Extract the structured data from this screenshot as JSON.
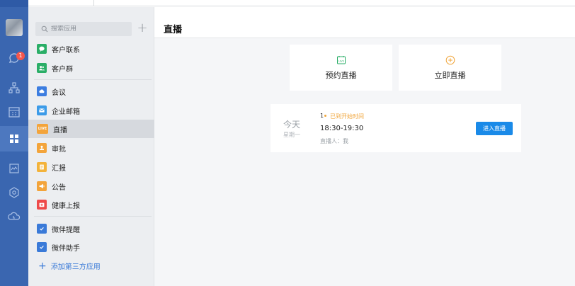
{
  "sidebar": {
    "search_placeholder": "搜索应用",
    "add_symbol": "+",
    "items": [
      {
        "label": "客户联系",
        "icon": "chat-bubble-icon",
        "color": "#2aae67"
      },
      {
        "label": "客户群",
        "icon": "group-icon",
        "color": "#2aae67"
      },
      {
        "label": "会议",
        "icon": "cloud-video-icon",
        "color": "#3c7de0"
      },
      {
        "label": "企业邮箱",
        "icon": "mail-icon",
        "color": "#3c9be8"
      },
      {
        "label": "直播",
        "icon": "live-icon",
        "icon_text": "LIVE",
        "color": "#f3a43b"
      },
      {
        "label": "审批",
        "icon": "approval-stamp-icon",
        "color": "#f3a43b"
      },
      {
        "label": "汇报",
        "icon": "report-doc-icon",
        "color": "#f3b33b"
      },
      {
        "label": "公告",
        "icon": "megaphone-icon",
        "color": "#f3a43b"
      },
      {
        "label": "健康上报",
        "icon": "medical-kit-icon",
        "color": "#ee4a4a"
      },
      {
        "label": "微伴提醒",
        "icon": "check-box-icon",
        "color": "#3a7ad8"
      },
      {
        "label": "微伴助手",
        "icon": "check-box-icon",
        "color": "#3a7ad8"
      }
    ],
    "add_third_party": "添加第三方应用"
  },
  "rail": {
    "badge_count": "1"
  },
  "main": {
    "title": "直播",
    "cards": {
      "schedule_label": "预约直播",
      "schedule_icon_text": "LIVE",
      "start_now_label": "立即直播"
    },
    "live": {
      "day": "今天",
      "weekday": "星期一",
      "count": "1",
      "status": "已到开始时间",
      "time_range": "18:30-19:30",
      "host": "直播人：我",
      "enter_button": "进入直播"
    }
  },
  "colors": {
    "rail": "#3a66b0",
    "accent": "#1a8ae8",
    "status_orange": "#f0a53a"
  }
}
